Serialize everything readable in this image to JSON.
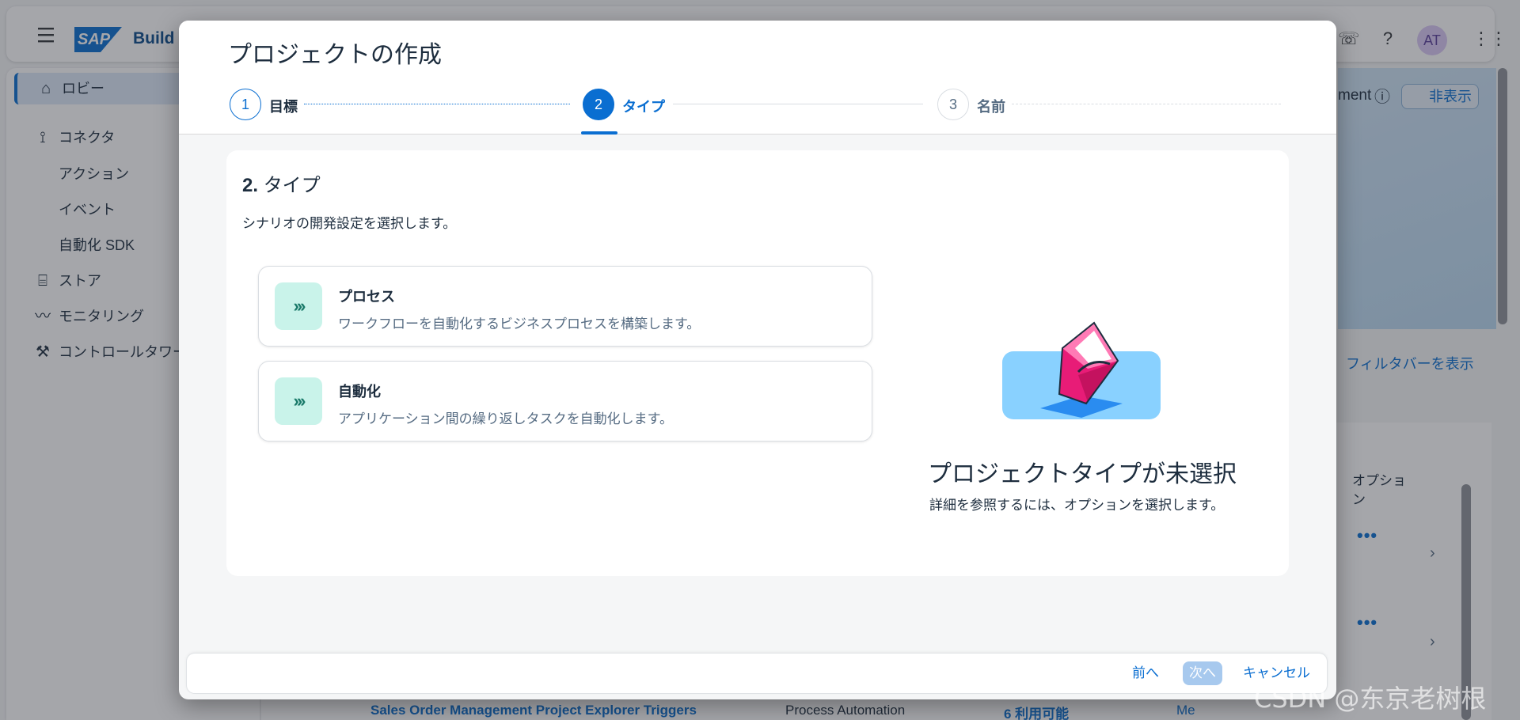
{
  "shell": {
    "product": "Build",
    "logo_text": "SAP",
    "avatar_initials": "AT"
  },
  "sidenav": {
    "items": [
      {
        "label": "ロビー",
        "icon": "home-icon"
      },
      {
        "label": "コネクタ",
        "icon": "connector-icon"
      },
      {
        "label": "アクション"
      },
      {
        "label": "イベント"
      },
      {
        "label": "自動化 SDK"
      },
      {
        "label": "ストア",
        "icon": "store-icon"
      },
      {
        "label": "モニタリング",
        "icon": "monitoring-icon"
      },
      {
        "label": "コントロールタワー",
        "icon": "wrench-icon"
      }
    ]
  },
  "background": {
    "partial_heading": "ment",
    "hide_button": "非表示",
    "filter_link": "フィルタバーを表示",
    "column_header": "オプショ\nン",
    "row": {
      "name": "Sales Order Management Project Explorer Triggers",
      "type": "Process Automation",
      "status": "6 利用可能",
      "owner": "Me"
    }
  },
  "dialog": {
    "title": "プロジェクトの作成",
    "steps": [
      {
        "number": "1",
        "label": "目標",
        "state": "done"
      },
      {
        "number": "2",
        "label": "タイプ",
        "state": "current"
      },
      {
        "number": "3",
        "label": "名前",
        "state": "todo"
      }
    ],
    "section_number": "2.",
    "section_title": "タイプ",
    "section_desc": "シナリオの開発設定を選択します。",
    "options": [
      {
        "title": "プロセス",
        "desc": "ワークフローを自動化するビジネスプロセスを構築します。",
        "icon": "chevrons-right-icon"
      },
      {
        "title": "自動化",
        "desc": "アプリケーション間の繰り返しタスクを自動化します。",
        "icon": "chevrons-right-icon"
      }
    ],
    "empty_state": {
      "title": "プロジェクトタイプが未選択",
      "desc": "詳細を参照するには、オプションを選択します。",
      "illustration": "envelope-illustration"
    },
    "footer": {
      "prev": "前へ",
      "next": "次へ",
      "cancel": "キャンセル"
    }
  },
  "watermark": "CSDN @东京老树根",
  "colors": {
    "accent": "#0a6ed1",
    "icon_bg": "#c9f3ea",
    "disabled_primary": "#a7c9ee"
  }
}
